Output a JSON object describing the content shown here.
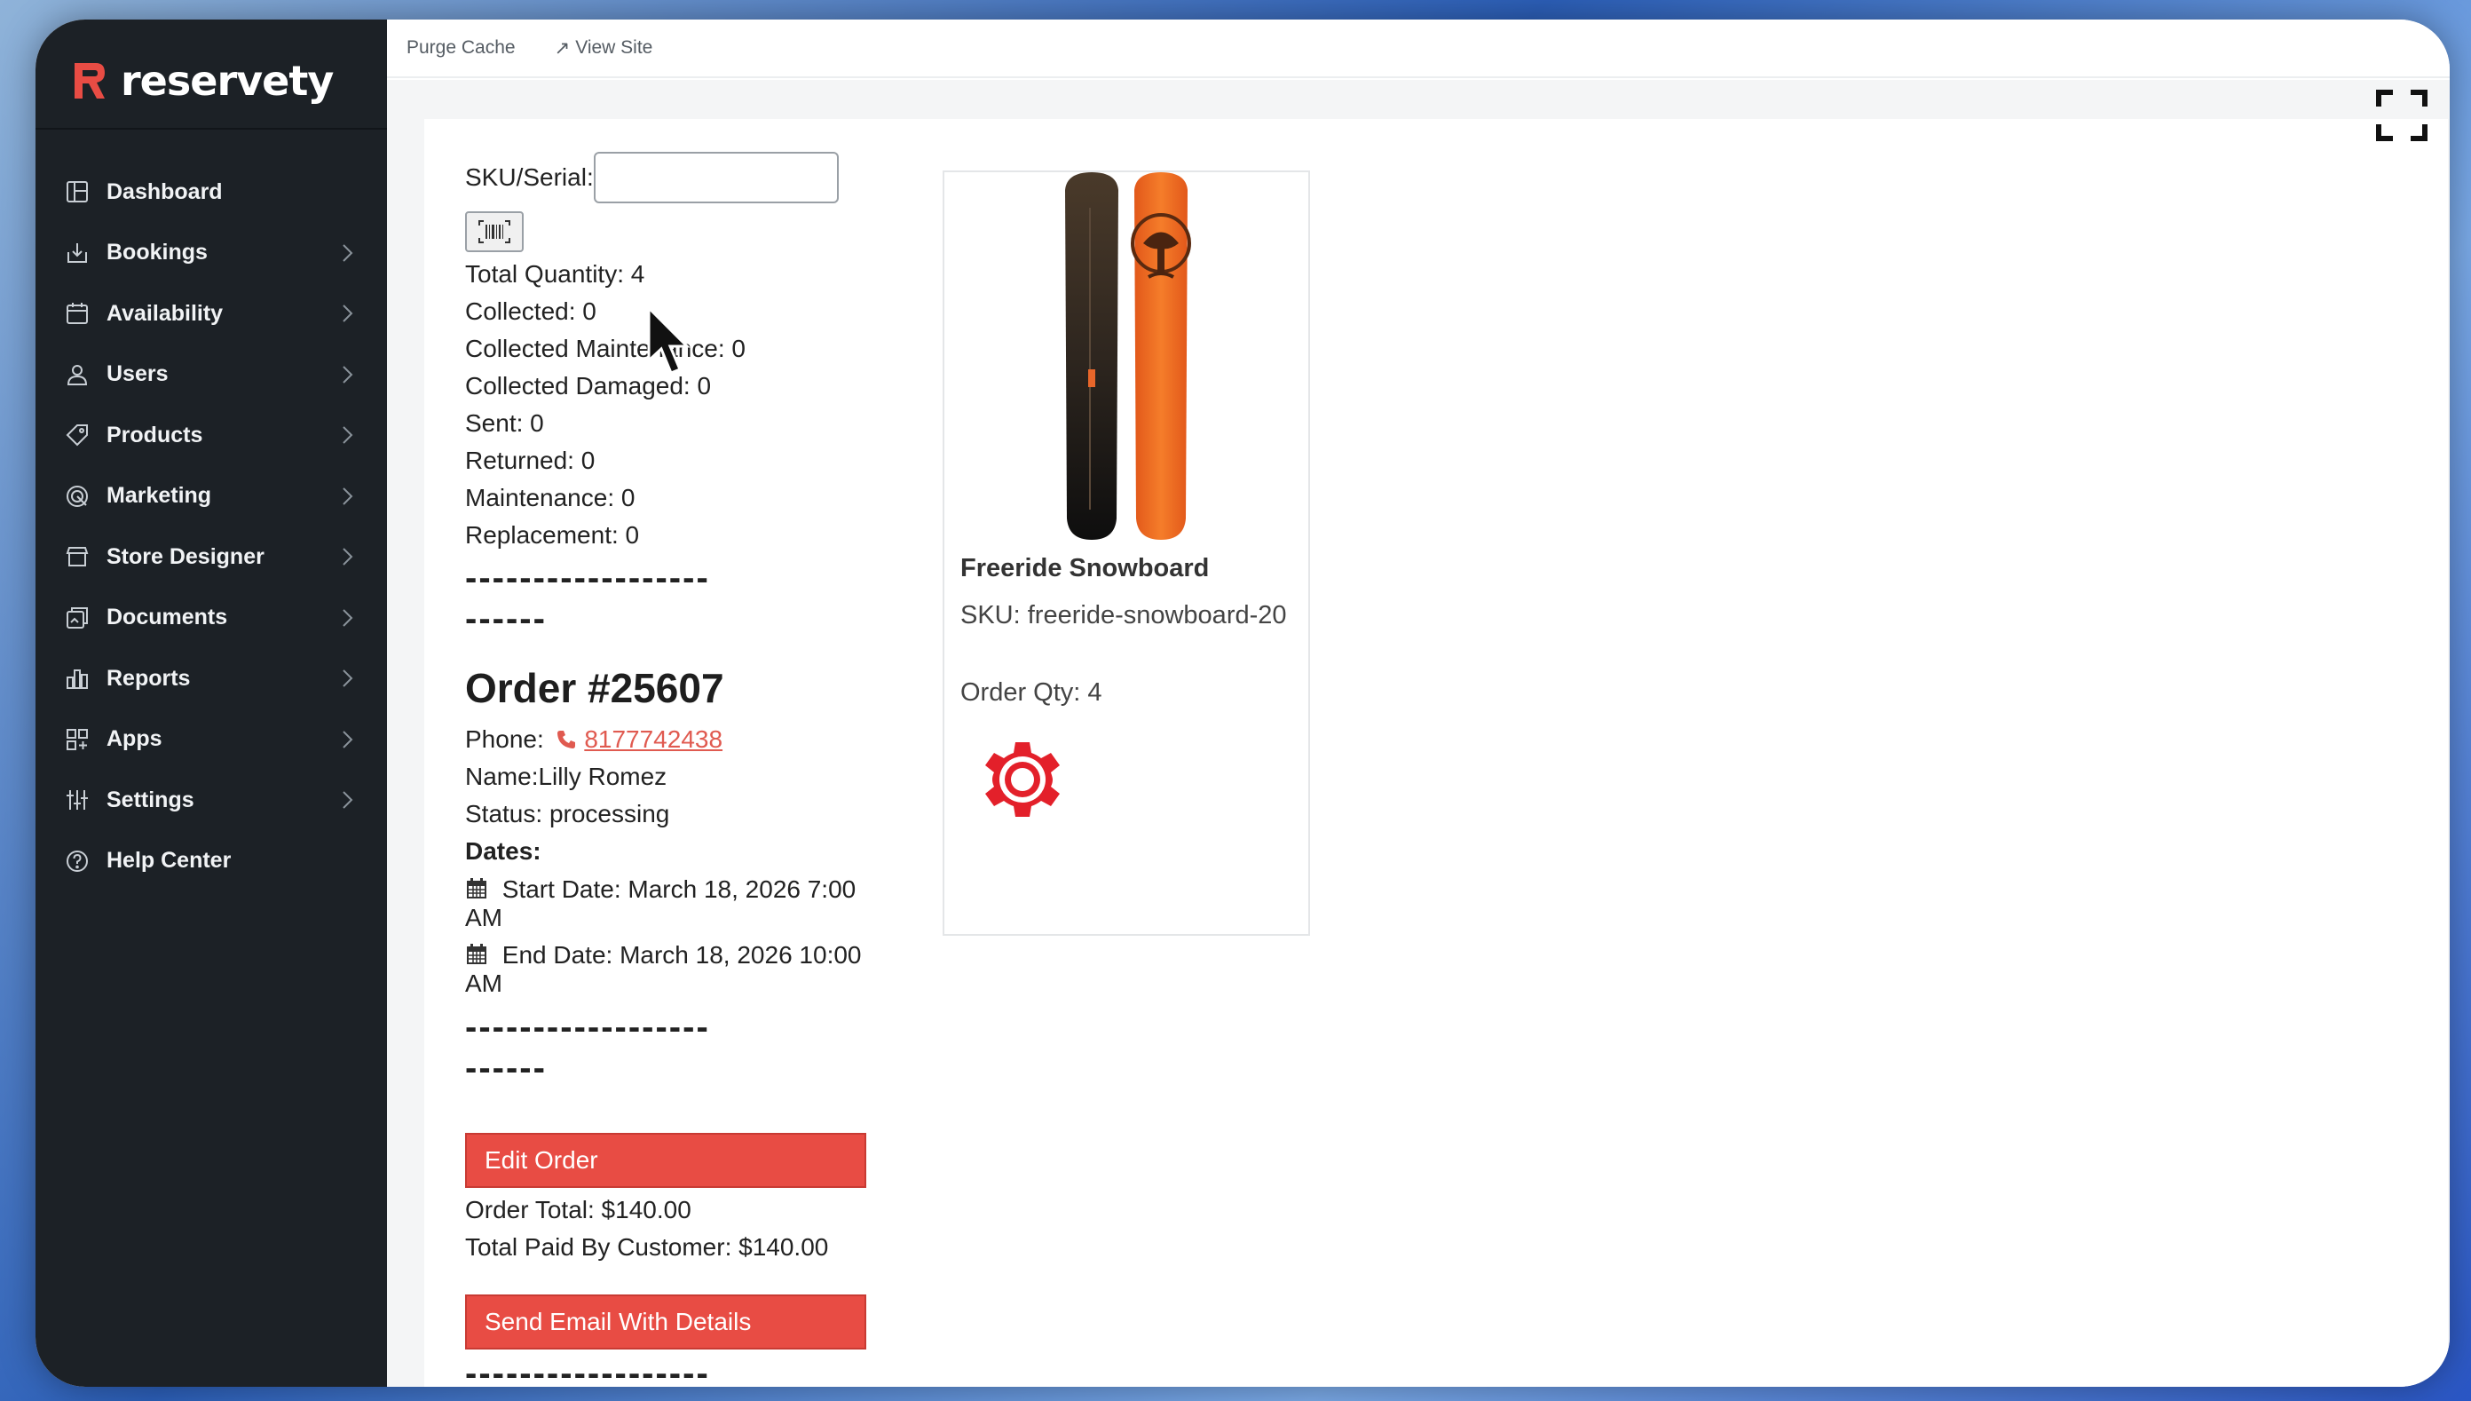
{
  "brand": {
    "name": "reservety",
    "accent": "#e84c44"
  },
  "sidebar": {
    "items": [
      {
        "label": "Dashboard",
        "icon": "dashboard-icon",
        "chevron": false
      },
      {
        "label": "Bookings",
        "icon": "bookings-icon",
        "chevron": true
      },
      {
        "label": "Availability",
        "icon": "calendar-icon",
        "chevron": true
      },
      {
        "label": "Users",
        "icon": "user-icon",
        "chevron": true
      },
      {
        "label": "Products",
        "icon": "tag-icon",
        "chevron": true
      },
      {
        "label": "Marketing",
        "icon": "target-icon",
        "chevron": true
      },
      {
        "label": "Store Designer",
        "icon": "store-icon",
        "chevron": true
      },
      {
        "label": "Documents",
        "icon": "documents-icon",
        "chevron": true
      },
      {
        "label": "Reports",
        "icon": "bar-chart-icon",
        "chevron": true
      },
      {
        "label": "Apps",
        "icon": "apps-icon",
        "chevron": true
      },
      {
        "label": "Settings",
        "icon": "sliders-icon",
        "chevron": true
      },
      {
        "label": "Help Center",
        "icon": "help-icon",
        "chevron": false
      }
    ]
  },
  "topbar": {
    "purge_cache": "Purge Cache",
    "view_site": "View Site"
  },
  "scan": {
    "sku_label": "SKU/Serial:",
    "sku_value": ""
  },
  "stats": [
    "Total Quantity: 4",
    "Collected: 0",
    "Collected Maintenance: 0",
    "Collected Damaged: 0",
    "Sent: 0",
    "Returned: 0",
    "Maintenance: 0",
    "Replacement: 0"
  ],
  "divider": "------------------\n------",
  "order": {
    "title": "Order #25607",
    "phone_label": "Phone:",
    "phone_number": "8177742438",
    "name": "Name:Lilly Romez",
    "status": "Status: processing",
    "dates_label": "Dates:",
    "start_date": "Start Date: March 18, 2026 7:00 AM",
    "end_date": "End Date: March 18, 2026 10:00 AM",
    "edit_button": "Edit Order",
    "total": "Order Total: $140.00",
    "paid": "Total Paid By Customer: $140.00",
    "email_button": "Send Email With Details"
  },
  "product": {
    "name": "Freeride Snowboard",
    "sku": "SKU: freeride-snowboard-20",
    "qty": "Order Qty: 4"
  }
}
